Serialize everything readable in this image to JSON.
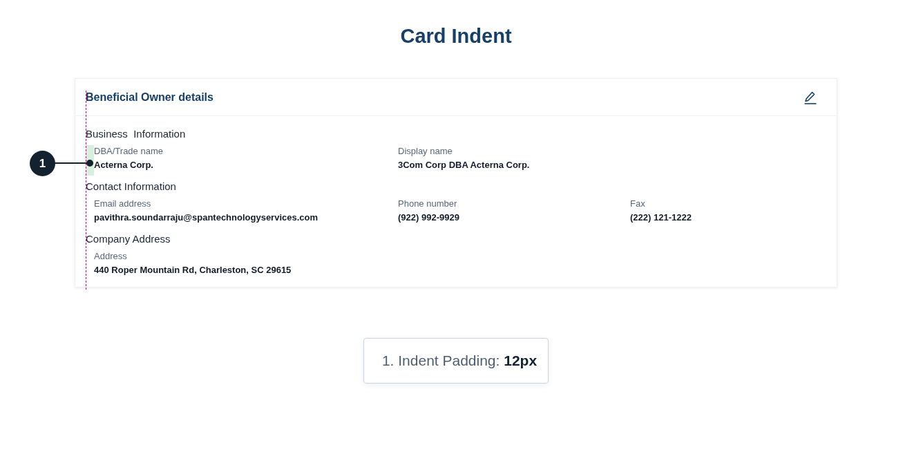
{
  "page_title": "Card Indent",
  "card": {
    "title": "Beneficial Owner details",
    "sections": [
      {
        "heading": "Business  Information",
        "fields": [
          {
            "label": "DBA/Trade name",
            "value": "Acterna Corp."
          },
          {
            "label": "Display name",
            "value": "3Com Corp DBA Acterna Corp."
          }
        ]
      },
      {
        "heading": "Contact Information",
        "fields": [
          {
            "label": "Email address",
            "value": "pavithra.soundarraju@spantechnologyservices.com"
          },
          {
            "label": "Phone number",
            "value": "(922) 992-9929"
          },
          {
            "label": "Fax",
            "value": "(222) 121-1222"
          }
        ]
      },
      {
        "heading": "Company Address",
        "fields": [
          {
            "label": "Address",
            "value": "440 Roper Mountain Rd, Charleston, SC 29615"
          }
        ]
      }
    ]
  },
  "annotation": {
    "number": "1"
  },
  "legend": [
    "1. Indent Padding: **12px**"
  ]
}
